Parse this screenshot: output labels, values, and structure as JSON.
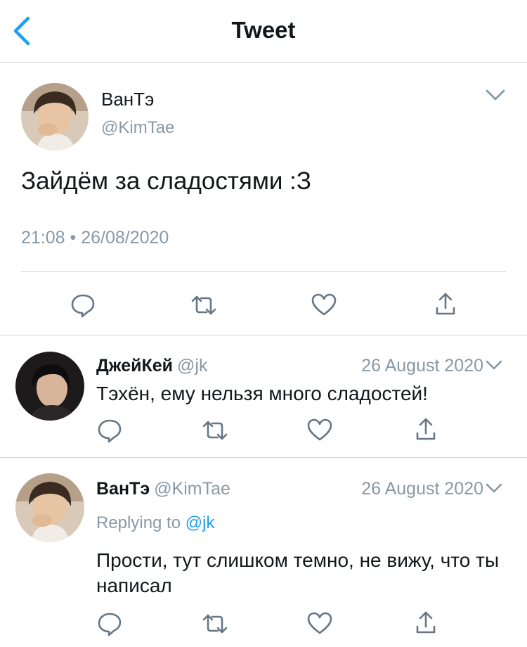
{
  "header": {
    "title": "Tweet",
    "back_icon": "chevron-left-icon"
  },
  "tweet": {
    "name": "ВанТэ",
    "handle": "@KimTae",
    "text": "Зайдём за сладостями :З",
    "timestamp": "21:08 • 26/08/2020",
    "actions": [
      "reply-icon",
      "retweet-icon",
      "like-icon",
      "share-icon"
    ]
  },
  "replies": [
    {
      "name": "ДжейКей",
      "handle": "@jk",
      "date": "26 August 2020",
      "text": "Тэхён, ему нельзя много сладостей!"
    },
    {
      "name": "ВанТэ",
      "handle": "@KimTae",
      "date": "26 August 2020",
      "replying_prefix": "Replying to",
      "replying_mention": "@jk",
      "text": "Прости, тут слишком темно, не вижу, что ты написал"
    }
  ],
  "colors": {
    "accent": "#1da1f2",
    "muted": "#8899a6",
    "icon": "#657786",
    "text": "#14171a",
    "divider": "#cfd3d6"
  }
}
